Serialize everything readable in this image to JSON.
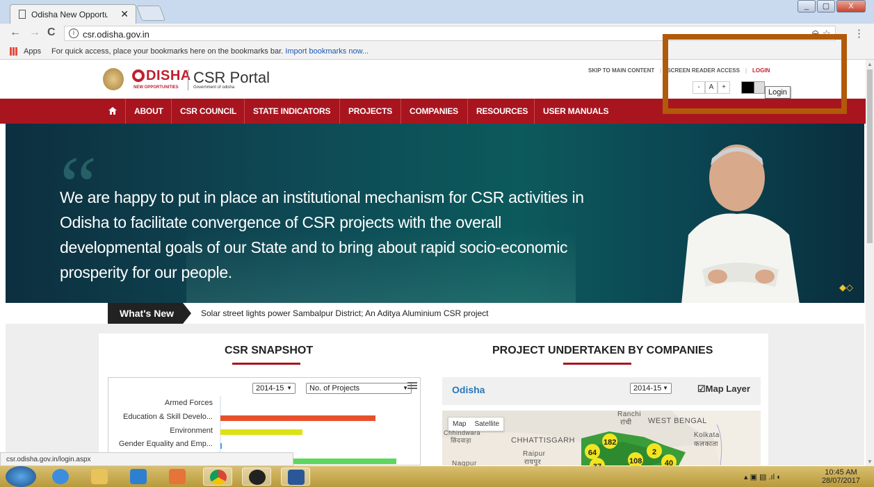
{
  "browser": {
    "tab_title": "Odisha New Opportuniti",
    "tab_close": "✕",
    "url": "csr.odisha.gov.in",
    "back": "←",
    "forward": "→",
    "reload": "C",
    "omnibox_icons": "⊖ ☆",
    "menu": "⋮",
    "bookmarks_apps": "Apps",
    "bookmarks_hint": "For quick access, place your bookmarks here on the bookmarks bar.",
    "bookmarks_import": "Import bookmarks now...",
    "status_url": "csr.odisha.gov.in/login.aspx",
    "window_buttons": [
      "_",
      "▢",
      "X"
    ]
  },
  "site": {
    "logo_main": "DISHA",
    "logo_sub": "NEW OPPORTUNITIES",
    "logo_gov": "Government of odisha",
    "portal_title": "CSR Portal",
    "top_links": {
      "skip": "SKIP TO MAIN CONTENT",
      "screen_reader": "SCREEN READER ACCESS",
      "separator": "|",
      "login": "LOGIN"
    },
    "font_controls": [
      "-",
      "A",
      "+"
    ],
    "tooltip": "Login",
    "nav": [
      "ABOUT",
      "CSR COUNCIL",
      "STATE INDICATORS",
      "PROJECTS",
      "COMPANIES",
      "RESOURCES",
      "USER MANUALS"
    ],
    "banner_quote": "We are happy to put in place an institutional mechanism for CSR activities in Odisha to facilitate convergence of CSR projects with the overall developmental goals of our State and to bring about rapid socio-economic prosperity for our people.",
    "whats_new_label": "What's New",
    "whats_new_text": "Solar street lights power Sambalpur District; An Aditya Aluminium CSR project",
    "snapshot_title": "CSR SNAPSHOT",
    "projects_title": "PROJECT UNDERTAKEN BY COMPANIES",
    "snapshot_year": "2014-15",
    "snapshot_metric": "No. of Projects",
    "map_title": "Odisha",
    "map_year": "2014-15",
    "map_layer": "Map Layer",
    "map_type": [
      "Map",
      "Satellite"
    ],
    "map_labels": [
      "Ranchi",
      "रांची",
      "WEST BENGAL",
      "Chhindwara",
      "छिंदवाड़ा",
      "CHHATTISGARH",
      "Kolkata",
      "कलकाता",
      "Raipur",
      "रायपुर",
      "Nagpur"
    ],
    "map_clusters": [
      "182",
      "64",
      "2",
      "108",
      "40",
      "37"
    ]
  },
  "chart_data": {
    "type": "bar",
    "orientation": "horizontal",
    "categories": [
      "Armed Forces",
      "Education & Skill Develo...",
      "Environment",
      "Gender Equality and Emp...",
      ""
    ],
    "colors": [
      "#e8502b",
      "#e8502b",
      "#dce314",
      "#3aa0e8",
      "#5cd65c"
    ],
    "values": [
      0,
      223,
      118,
      2,
      253
    ],
    "xlim": [
      0,
      285
    ]
  },
  "taskbar": {
    "time": "10:45 AM",
    "date": "28/07/2017"
  }
}
